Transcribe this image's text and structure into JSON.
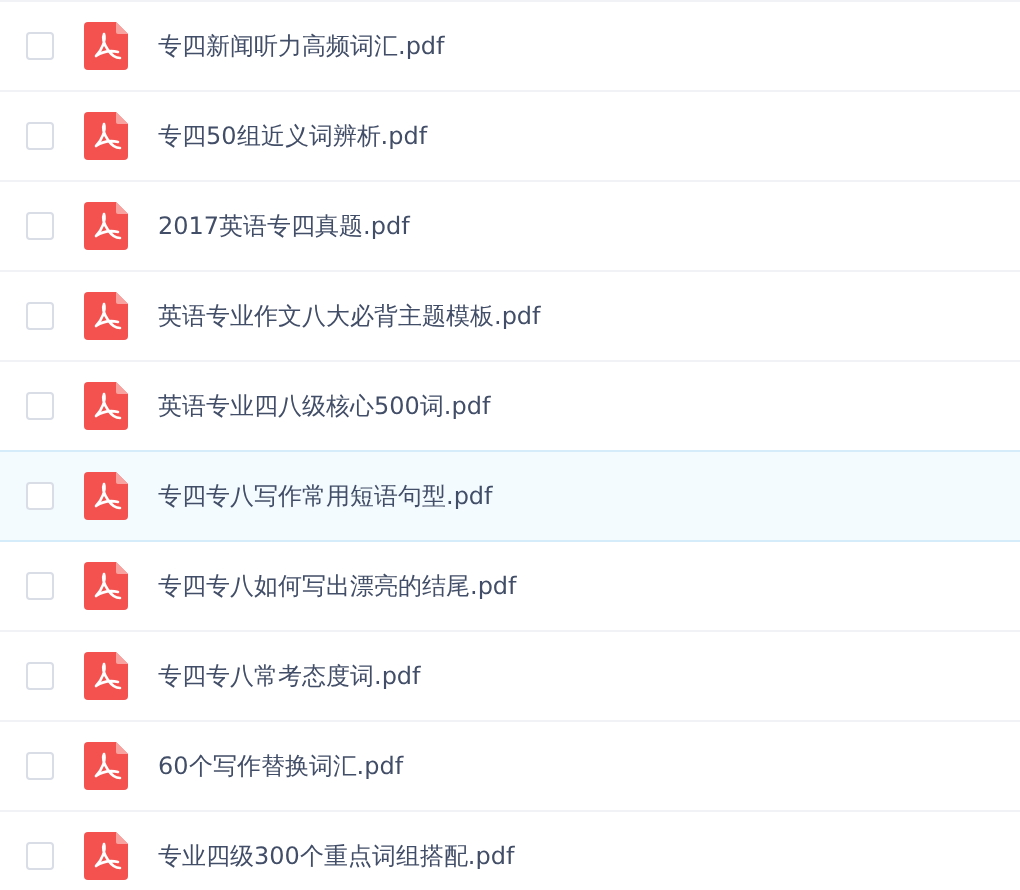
{
  "files": [
    {
      "name": "专四新闻听力高频词汇.pdf",
      "checked": false,
      "highlighted": false
    },
    {
      "name": "专四50组近义词辨析.pdf",
      "checked": false,
      "highlighted": false
    },
    {
      "name": "2017英语专四真题.pdf",
      "checked": false,
      "highlighted": false
    },
    {
      "name": "英语专业作文八大必背主题模板.pdf",
      "checked": false,
      "highlighted": false
    },
    {
      "name": "英语专业四八级核心500词.pdf",
      "checked": false,
      "highlighted": false
    },
    {
      "name": "专四专八写作常用短语句型.pdf",
      "checked": false,
      "highlighted": true
    },
    {
      "name": "专四专八如何写出漂亮的结尾.pdf",
      "checked": false,
      "highlighted": false
    },
    {
      "name": "专四专八常考态度词.pdf",
      "checked": false,
      "highlighted": false
    },
    {
      "name": "60个写作替换词汇.pdf",
      "checked": false,
      "highlighted": false
    },
    {
      "name": "专业四级300个重点词组搭配.pdf",
      "checked": false,
      "highlighted": false
    }
  ]
}
